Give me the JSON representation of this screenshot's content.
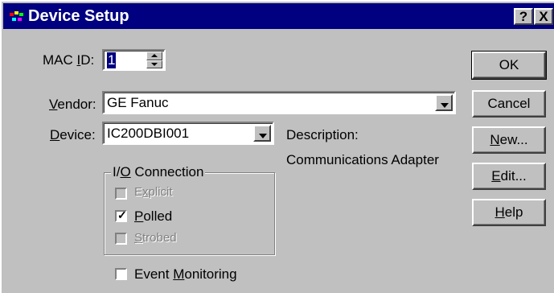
{
  "window": {
    "title": "Device Setup",
    "help_glyph": "?",
    "close_glyph": "X"
  },
  "form": {
    "mac_id": {
      "label_pre": "MAC ",
      "label_ul": "I",
      "label_post": "D:",
      "value": "1"
    },
    "vendor": {
      "label_ul": "V",
      "label_post": "endor:",
      "value": "GE Fanuc"
    },
    "device": {
      "label_ul": "D",
      "label_post": "evice:",
      "value": "IC200DBI001"
    },
    "description": {
      "label": "Description:",
      "value": "Communications Adapter"
    }
  },
  "io_connection": {
    "title_pre": "I/",
    "title_ul": "O",
    "title_post": " Connection",
    "options": [
      {
        "label_pre": "E",
        "label_ul": "x",
        "label_post": "plicit",
        "checked": false,
        "enabled": false
      },
      {
        "label_pre": "",
        "label_ul": "P",
        "label_post": "olled",
        "checked": true,
        "enabled": true
      },
      {
        "label_pre": "",
        "label_ul": "S",
        "label_post": "trobed",
        "checked": false,
        "enabled": false
      }
    ]
  },
  "event_monitoring": {
    "label_pre": "Event ",
    "label_ul": "M",
    "label_post": "onitoring",
    "checked": false
  },
  "buttons": {
    "ok": "OK",
    "cancel": "Cancel",
    "new_ul": "N",
    "new_post": "ew...",
    "edit_ul": "E",
    "edit_post": "dit...",
    "help_ul": "H",
    "help_post": "elp"
  },
  "colors": {
    "titlebar": "#000080",
    "face": "#c0c0c0"
  }
}
